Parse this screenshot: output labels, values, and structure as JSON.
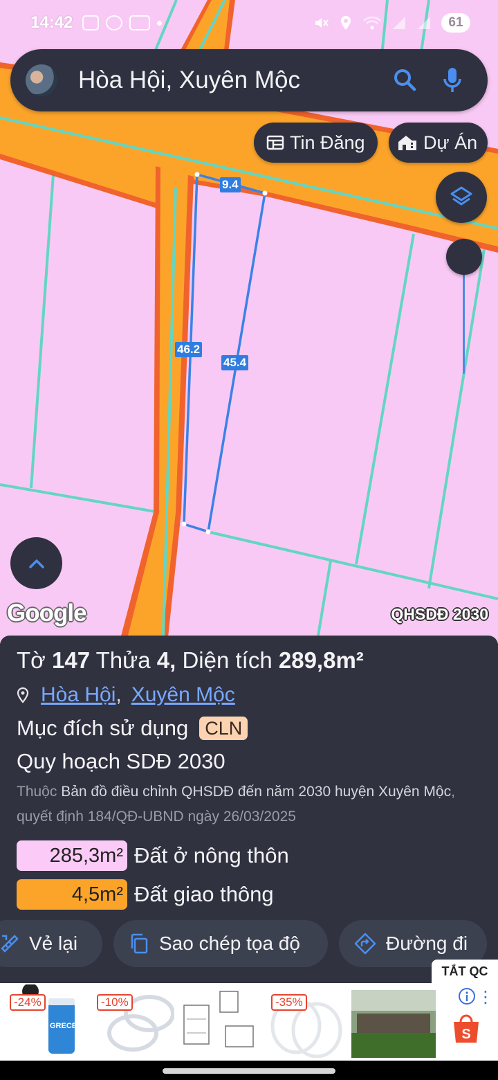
{
  "status_bar": {
    "time": "14:42",
    "battery": "61",
    "icons": [
      "screenshot-icon",
      "messenger-icon",
      "zalo-icon",
      "notification-dot",
      "mute-icon",
      "location-icon",
      "wifi-icon",
      "signal-icon",
      "signal-icon"
    ]
  },
  "search": {
    "query": "Hòa Hội, Xuyên Mộc",
    "search_icon": "search-icon",
    "mic_icon": "mic-icon"
  },
  "chips": {
    "tin_dang": "Tin Đăng",
    "du_an": "Dự Án"
  },
  "map": {
    "dimensions": {
      "top": "9.4",
      "left": "46.2",
      "right": "45.4"
    },
    "google_logo": "Google",
    "layer_label": "QHSDĐ 2030",
    "colors": {
      "land": "#f9c9f5",
      "road": "#fca42a",
      "road_edge": "#f0632c",
      "parcel_line": "#63d6c3",
      "selection": "#3b82e6"
    }
  },
  "panel": {
    "title_prefix": "Tờ",
    "sheet_no": "147",
    "parcel_label": "Thửa",
    "parcel_no": "4,",
    "area_label": "Diện tích",
    "area_value": "289,8m²",
    "location": {
      "commune": "Hòa Hội",
      "district": "Xuyên Mộc"
    },
    "purpose_label": "Mục đích sử dụng",
    "purpose_code": "CLN",
    "plan_title": "Quy hoạch SDĐ 2030",
    "desc_prefix": "Thuộc",
    "desc_main": "Bản đồ điều chỉnh QHSDĐ đến năm 2030 huyện Xuyên Mộc",
    "desc_decision": ", quyết định 184/QĐ-UBND ngày 26/03/2025",
    "legend": [
      {
        "area": "285,3m²",
        "label": "Đất ở nông thôn",
        "color": "#fbcaf6"
      },
      {
        "area": "4,5m²",
        "label": "Đất giao thông",
        "color": "#fca42a"
      }
    ],
    "actions": {
      "redraw": "Vẻ lại",
      "copy_coords": "Sao chép tọa độ",
      "directions": "Đường đi"
    }
  },
  "ad": {
    "close_label": "TẮT QC",
    "discounts": [
      "-24%",
      "-10%",
      "-35%"
    ],
    "product_brand": "GRECE"
  }
}
